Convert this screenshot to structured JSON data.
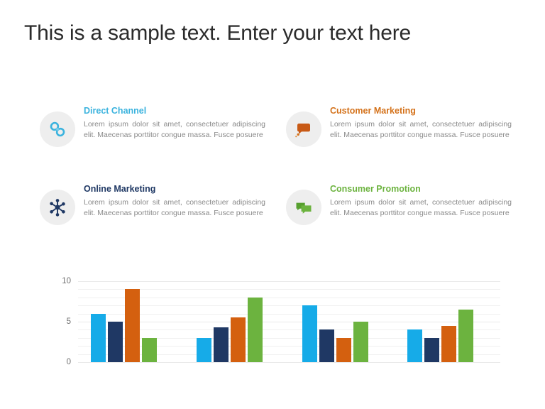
{
  "title": "This is a sample text. Enter your text here",
  "features": [
    {
      "id": "direct-channel",
      "title": "Direct Channel",
      "color": "#3BB3DE",
      "icon": "chain-link-icon",
      "text": "Lorem ipsum dolor sit amet, consectetuer adipiscing elit. Maecenas porttitor congue massa. Fusce posuere"
    },
    {
      "id": "customer-marketing",
      "title": "Customer Marketing",
      "color": "#D4721B",
      "icon": "speech-bubble-icon",
      "text": "Lorem ipsum dolor sit amet, consectetuer adipiscing elit. Maecenas porttitor congue massa. Fusce posuere"
    },
    {
      "id": "online-marketing",
      "title": "Online Marketing",
      "color": "#1F3864",
      "icon": "network-hub-icon",
      "text": "Lorem ipsum dolor sit amet, consectetuer adipiscing elit. Maecenas porttitor congue massa. Fusce posuere"
    },
    {
      "id": "consumer-promotion",
      "title": "Consumer Promotion",
      "color": "#6CB33F",
      "icon": "chat-bubbles-icon",
      "text": "Lorem ipsum dolor sit amet, consectetuer adipiscing elit. Maecenas porttitor congue massa. Fusce posuere"
    }
  ],
  "chart_data": {
    "type": "bar",
    "title": "",
    "xlabel": "",
    "ylabel": "",
    "ylim": [
      0,
      10
    ],
    "yticks": [
      0,
      5,
      10
    ],
    "ytick_labels": [
      "0",
      "5",
      "10"
    ],
    "grid": true,
    "grid_step": 1,
    "legend": "none",
    "categories": [
      "",
      "",
      "",
      ""
    ],
    "series": [
      {
        "name": "Direct Channel",
        "color": "#16ABE8",
        "values": [
          6,
          3,
          7,
          4
        ]
      },
      {
        "name": "Online Marketing",
        "color": "#1F3864",
        "values": [
          5,
          4.3,
          4,
          3
        ]
      },
      {
        "name": "Customer Marketing",
        "color": "#D4600F",
        "values": [
          9,
          5.5,
          3,
          4.5
        ]
      },
      {
        "name": "Consumer Promotion",
        "color": "#6CB33F",
        "values": [
          3,
          8,
          5,
          6.5
        ]
      }
    ]
  }
}
